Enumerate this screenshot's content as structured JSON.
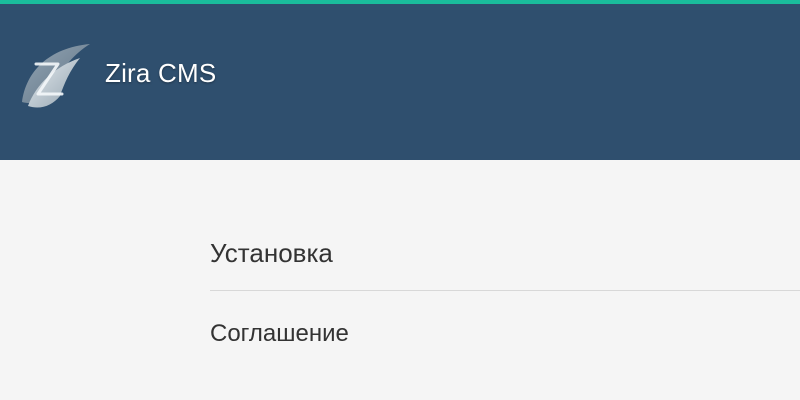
{
  "app": {
    "name": "Zira CMS",
    "accent_color": "#1abc9c",
    "header_color": "#2f4f6e"
  },
  "header": {
    "logo_icon": "zira-leaf-logo-icon",
    "title": "Zira CMS"
  },
  "main": {
    "heading": "Установка",
    "section_title": "Соглашение"
  }
}
